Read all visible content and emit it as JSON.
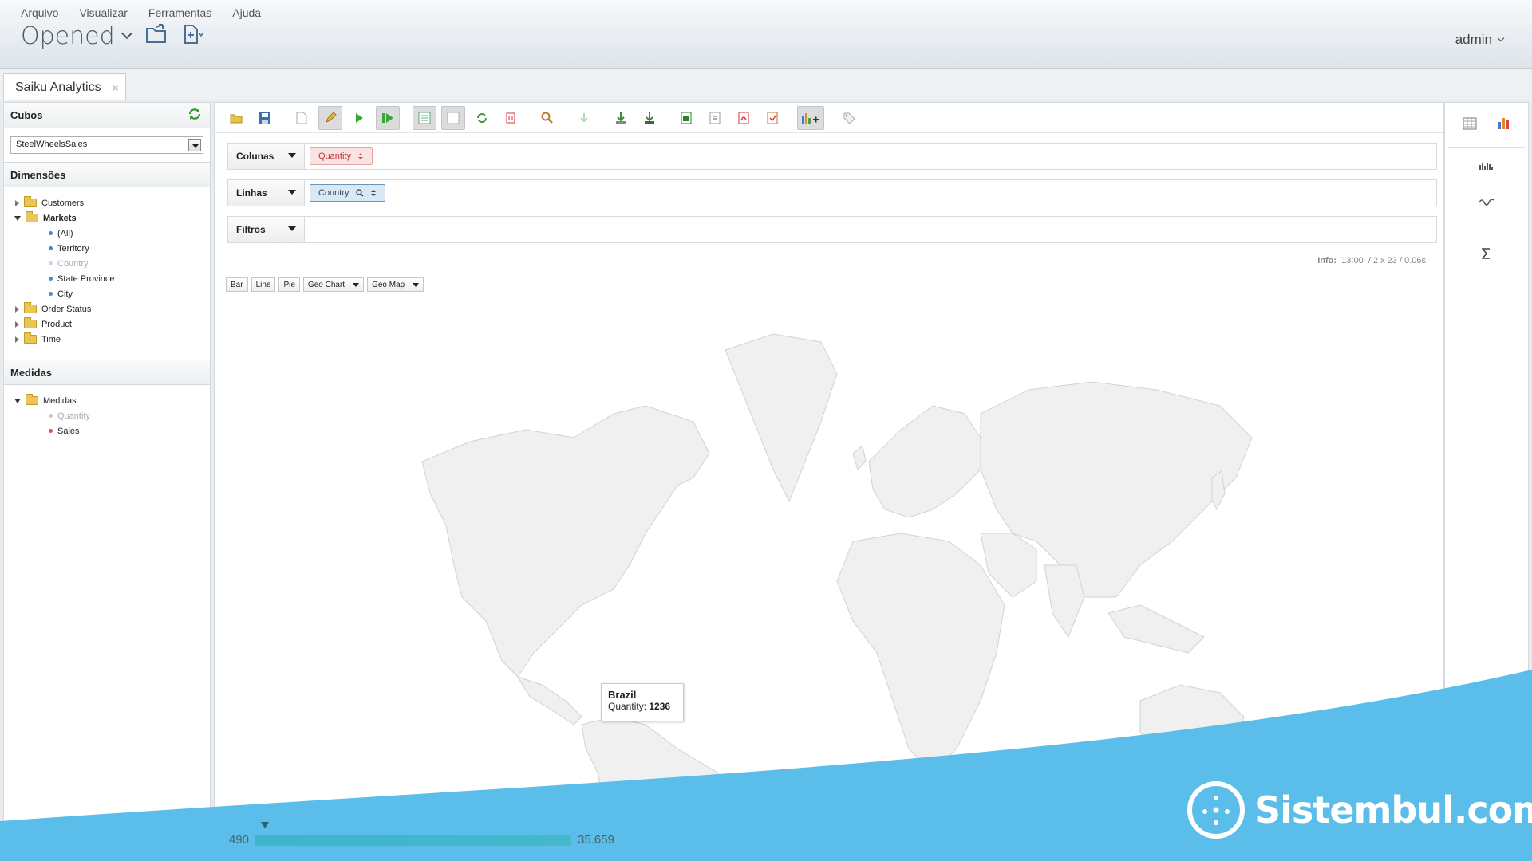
{
  "menu": [
    "Arquivo",
    "Visualizar",
    "Ferramentas",
    "Ajuda"
  ],
  "header": {
    "title": "Opened",
    "user": "admin"
  },
  "tab": {
    "label": "Saiku Analytics",
    "close": "×"
  },
  "left": {
    "cubes_title": "Cubos",
    "cube_selected": "SteelWheelsSales",
    "dimensions_title": "Dimensões",
    "dimensions": [
      {
        "label": "Customers",
        "expanded": false
      },
      {
        "label": "Markets",
        "expanded": true,
        "levels": [
          {
            "label": "(All)",
            "state": "normal"
          },
          {
            "label": "Territory",
            "state": "normal"
          },
          {
            "label": "Country",
            "state": "used"
          },
          {
            "label": "State Province",
            "state": "normal"
          },
          {
            "label": "City",
            "state": "normal"
          }
        ]
      },
      {
        "label": "Order Status",
        "expanded": false
      },
      {
        "label": "Product",
        "expanded": false
      },
      {
        "label": "Time",
        "expanded": false
      }
    ],
    "measures_title": "Medidas",
    "measures_folder": "Medidas",
    "measures": [
      {
        "label": "Quantity",
        "state": "used"
      },
      {
        "label": "Sales",
        "state": "normal"
      }
    ]
  },
  "axes": {
    "columns_label": "Colunas",
    "columns_pill": "Quantity",
    "rows_label": "Linhas",
    "rows_pill": "Country",
    "filters_label": "Filtros"
  },
  "info": {
    "label": "Info:",
    "time": "13:00",
    "size": "2 x 23",
    "duration": "0.06s"
  },
  "chart_types": [
    "Bar",
    "Line",
    "Pie",
    "Geo Chart",
    "Geo Map"
  ],
  "tooltip": {
    "title": "Brazil",
    "label": "Quantity:",
    "value": "1236"
  },
  "legend": {
    "min": "490",
    "max": "35.659"
  },
  "brand": "Sistembul.com",
  "colors": {
    "accent_wave": "#5bbde9",
    "land": "#f0f0f0",
    "border": "#d2d2d2"
  }
}
